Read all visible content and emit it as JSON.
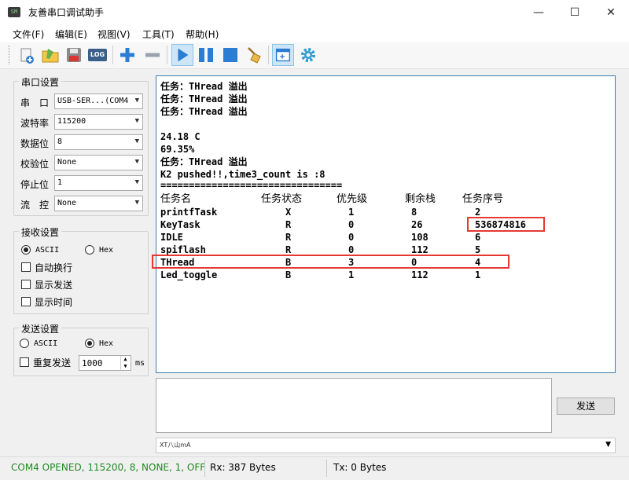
{
  "window": {
    "title": "友善串口调试助手",
    "app_icon_text": "SM",
    "minimize": "—",
    "maximize": "☐",
    "close": "✕"
  },
  "menu": [
    "文件(F)",
    "编辑(E)",
    "视图(V)",
    "工具(T)",
    "帮助(H)"
  ],
  "toolbar": {
    "icons": [
      "new-file-icon",
      "open-folder-icon",
      "save-icon",
      "log-icon",
      "add-icon",
      "remove-icon",
      "play-icon",
      "pause-icon",
      "stop-icon",
      "clear-broom-icon",
      "insert-panel-icon",
      "settings-gear-icon"
    ],
    "log_label": "LOG",
    "colors": {
      "blue": "#2b7cd3",
      "gray": "#9aa3ad",
      "selected_bg": "#cde6f7"
    }
  },
  "serial_settings": {
    "title": "串口设置",
    "fields": [
      {
        "label": "串　口",
        "value": "USB-SER...(COM4"
      },
      {
        "label": "波特率",
        "value": "115200"
      },
      {
        "label": "数据位",
        "value": "8"
      },
      {
        "label": "校验位",
        "value": "None"
      },
      {
        "label": "停止位",
        "value": "1"
      },
      {
        "label": "流　控",
        "value": "None"
      }
    ]
  },
  "receive_settings": {
    "title": "接收设置",
    "ascii": "ASCII",
    "hex": "Hex",
    "selected": "ASCII",
    "checkboxes": [
      "自动换行",
      "显示发送",
      "显示时间"
    ]
  },
  "send_settings": {
    "title": "发送设置",
    "ascii": "ASCII",
    "hex": "Hex",
    "selected": "Hex",
    "repeat_label": "重复发送",
    "repeat_value": "1000",
    "unit": "ms"
  },
  "receive_text": {
    "lines": [
      "任务：THread 溢出",
      "任务：THread 溢出",
      "任务：THread 溢出",
      "",
      "24.18 C",
      "69.35%",
      "任务：THread 溢出",
      "K2 pushed!!,time3_count is :8",
      "================================"
    ],
    "table_headers": [
      "任务名",
      "任务状态",
      "优先级",
      "剩余栈",
      "任务序号"
    ],
    "table_rows": [
      [
        "printfTask",
        "X",
        "1",
        "8",
        "2"
      ],
      [
        "KeyTask",
        "R",
        "0",
        "26",
        "536874816"
      ],
      [
        "IDLE",
        "R",
        "0",
        "108",
        "6"
      ],
      [
        "spiflash",
        "R",
        "0",
        "112",
        "5"
      ],
      [
        "THread",
        "B",
        "3",
        "0",
        "4"
      ],
      [
        "Led_toggle",
        "B",
        "1",
        "112",
        "1"
      ]
    ],
    "highlight_color": "#e53935"
  },
  "send": {
    "button_label": "发送",
    "history_value": "XT八山mA"
  },
  "status": {
    "connection": "COM4 OPENED, 115200, 8, NONE, 1, OFF",
    "rx": "Rx: 387 Bytes",
    "tx": "Tx: 0 Bytes",
    "connection_color": "#1e8a1e"
  }
}
